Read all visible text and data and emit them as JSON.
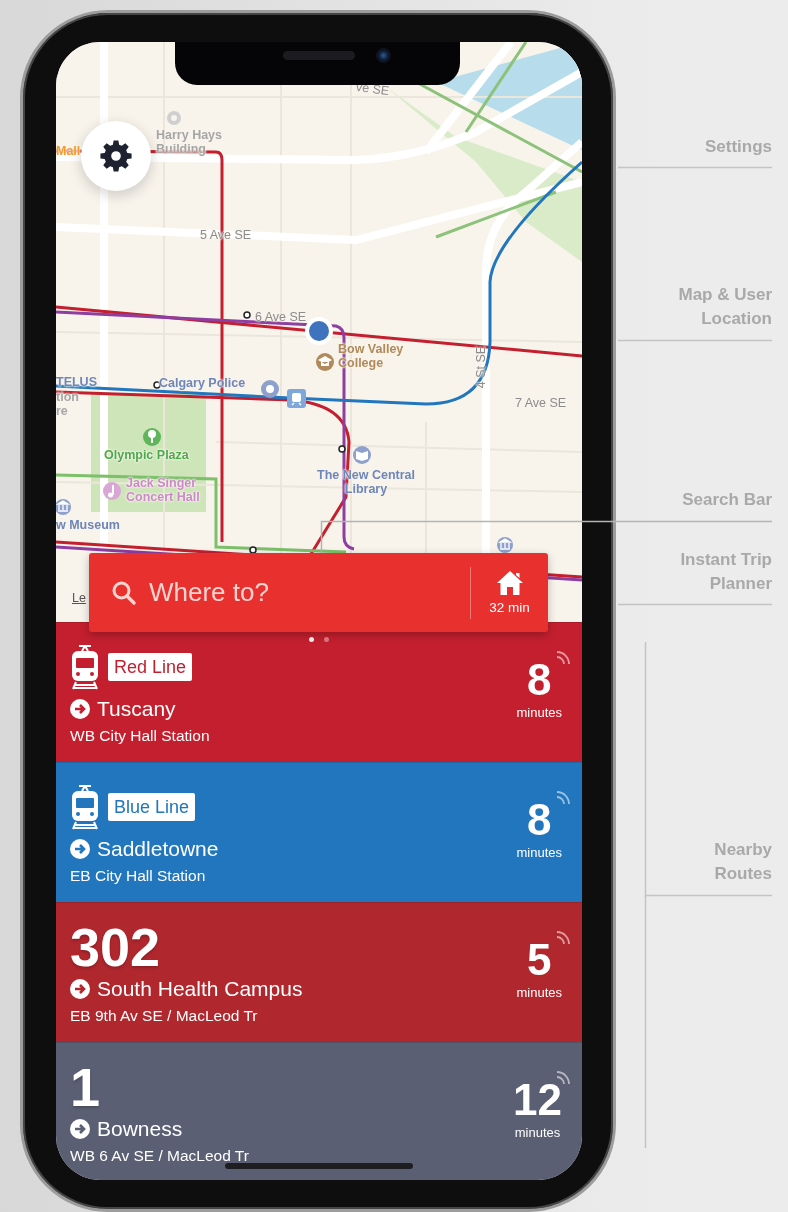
{
  "map": {
    "labels": [
      {
        "text": "ve SE",
        "kind": "street"
      },
      {
        "text": "Mall",
        "kind": "shop"
      },
      {
        "text": "Harry Hays Building",
        "kind": "building"
      },
      {
        "text": "5 Ave SE",
        "kind": "street"
      },
      {
        "text": "6 Ave SE",
        "kind": "street"
      },
      {
        "text": "Bow Valley College",
        "kind": "school"
      },
      {
        "text": "TELUS",
        "kind": "culture"
      },
      {
        "text": "tion",
        "kind": "building"
      },
      {
        "text": "re",
        "kind": "building"
      },
      {
        "text": "Calgary Police",
        "kind": "culture"
      },
      {
        "text": "4 St SE",
        "kind": "street"
      },
      {
        "text": "7 Ave SE",
        "kind": "street"
      },
      {
        "text": "Olympic Plaza",
        "kind": "park"
      },
      {
        "text": "Jack Singer Concert Hall",
        "kind": "music"
      },
      {
        "text": "The New Central Library",
        "kind": "culture"
      },
      {
        "text": "w Museum",
        "kind": "culture"
      },
      {
        "text": "Le",
        "kind": "legal"
      }
    ]
  },
  "search": {
    "placeholder": "Where to?",
    "trip_planner": "32 min"
  },
  "pager": [
    {
      "selected": true
    },
    {
      "selected": false
    }
  ],
  "routes": [
    {
      "kind": "train",
      "label": "Red Line",
      "color": "#c41f2e",
      "destination": "Tuscany",
      "stop": "WB City Hall Station",
      "minutes": "8",
      "unit": "minutes"
    },
    {
      "kind": "train",
      "label": "Blue Line",
      "color": "#2176bd",
      "destination": "Saddletowne",
      "stop": "EB City Hall Station",
      "minutes": "8",
      "unit": "minutes"
    },
    {
      "kind": "bus",
      "label": "302",
      "color": "#b0272e",
      "destination": "South Health Campus",
      "stop": "EB 9th Av SE / MacLeod Tr",
      "minutes": "5",
      "unit": "minutes"
    },
    {
      "kind": "bus",
      "label": "1",
      "color": "#5a5f73",
      "destination": "Bowness",
      "stop": "WB 6 Av SE / MacLeod Tr",
      "minutes": "12",
      "unit": "minutes"
    }
  ],
  "annotations": [
    {
      "text": "Settings"
    },
    {
      "text": "Map & User Location"
    },
    {
      "text": "Search Bar"
    },
    {
      "text": "Instant Trip Planner"
    },
    {
      "text": "Nearby Routes"
    }
  ]
}
